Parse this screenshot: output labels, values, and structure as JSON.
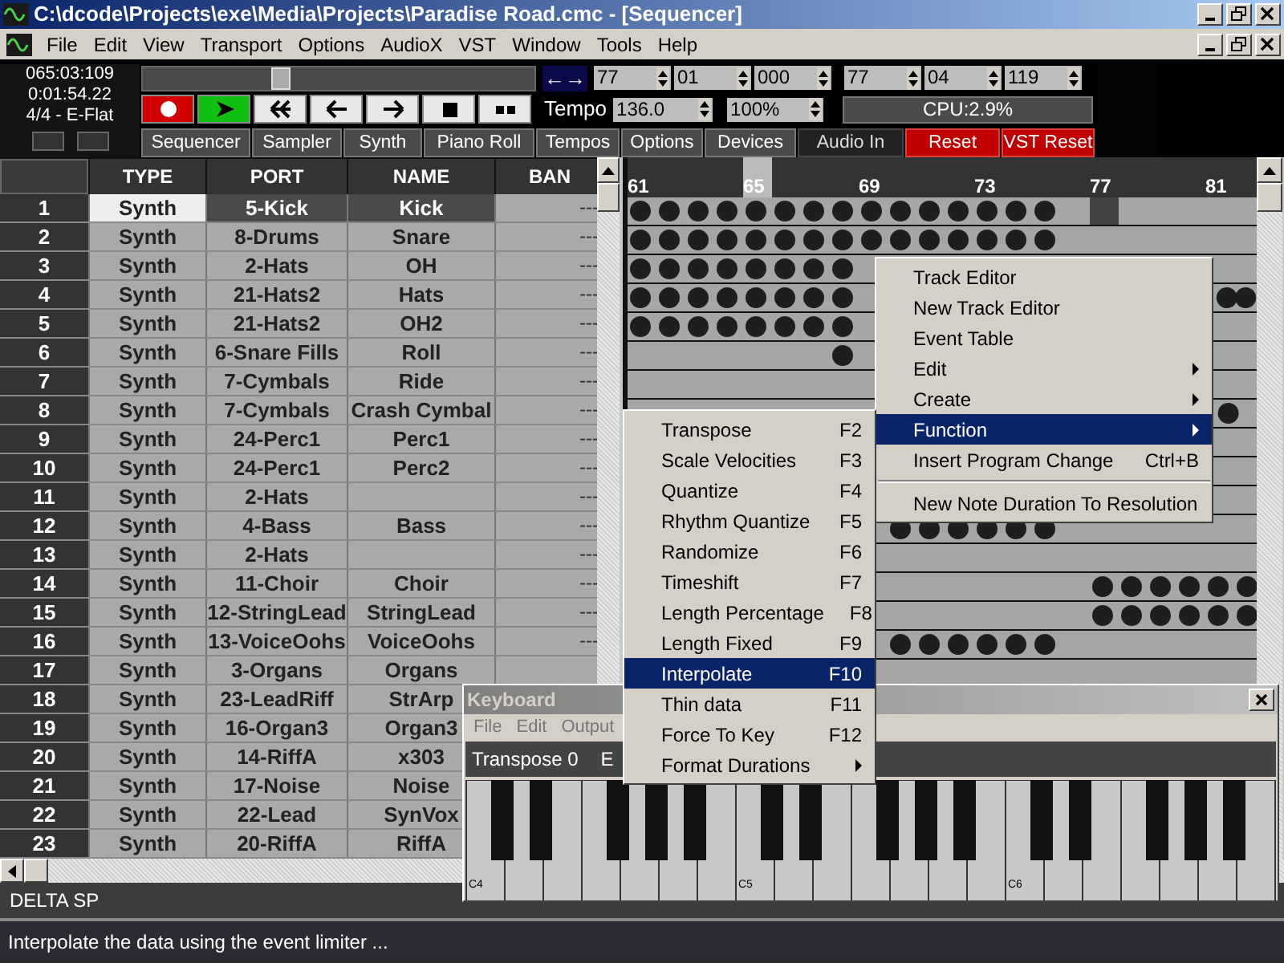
{
  "window": {
    "title": "C:\\dcode\\Projects\\exe\\Media\\Projects\\Paradise Road.cmc - [Sequencer]"
  },
  "menu_bar": [
    "File",
    "Edit",
    "View",
    "Transport",
    "Options",
    "AudioX",
    "VST",
    "Window",
    "Tools",
    "Help"
  ],
  "position": {
    "bar_beat_tick": "065:03:109",
    "time": "0:01:54.22",
    "signature_key": "4/4 - E-Flat"
  },
  "song_slider": {
    "level": 0.34
  },
  "transport": [
    {
      "kind": "record"
    },
    {
      "kind": "play"
    },
    {
      "kind": "rewind"
    },
    {
      "kind": "back"
    },
    {
      "kind": "forward"
    },
    {
      "kind": "stop"
    },
    {
      "kind": "end"
    }
  ],
  "loop_toggle": "←→",
  "locators": [
    "77",
    "01",
    "000",
    "77",
    "04",
    "119"
  ],
  "tempo": {
    "label": "Tempo",
    "value": "136.0",
    "speed": "100%"
  },
  "cpu": "CPU:2.9%",
  "view_tabs": [
    {
      "label": "Sequencer",
      "kind": "normal"
    },
    {
      "label": "Sampler",
      "kind": "normal"
    },
    {
      "label": "Synth",
      "kind": "normal"
    },
    {
      "label": "Piano Roll",
      "kind": "normal"
    },
    {
      "label": "Tempos",
      "kind": "normal"
    },
    {
      "label": "Options",
      "kind": "normal"
    },
    {
      "label": "Devices",
      "kind": "normal"
    },
    {
      "label": "Audio In",
      "kind": "dark"
    },
    {
      "label": "Reset",
      "kind": "alert"
    },
    {
      "label": "VST Reset",
      "kind": "alert"
    }
  ],
  "tracks": {
    "columns": [
      "TYPE",
      "PORT",
      "NAME",
      "BAN"
    ],
    "rows": [
      {
        "number": "1",
        "type": "Synth",
        "port": "5-Kick",
        "name": "Kick",
        "bank": "---",
        "selected": true
      },
      {
        "number": "2",
        "type": "Synth",
        "port": "8-Drums",
        "name": "Snare",
        "bank": "---",
        "selected": false
      },
      {
        "number": "3",
        "type": "Synth",
        "port": "2-Hats",
        "name": "OH",
        "bank": "---",
        "selected": false
      },
      {
        "number": "4",
        "type": "Synth",
        "port": "21-Hats2",
        "name": "Hats",
        "bank": "---",
        "selected": false
      },
      {
        "number": "5",
        "type": "Synth",
        "port": "21-Hats2",
        "name": "OH2",
        "bank": "---",
        "selected": false
      },
      {
        "number": "6",
        "type": "Synth",
        "port": "6-Snare Fills",
        "name": "Roll",
        "bank": "---",
        "selected": false
      },
      {
        "number": "7",
        "type": "Synth",
        "port": "7-Cymbals",
        "name": "Ride",
        "bank": "---",
        "selected": false
      },
      {
        "number": "8",
        "type": "Synth",
        "port": "7-Cymbals",
        "name": "Crash Cymbal",
        "bank": "---",
        "selected": false
      },
      {
        "number": "9",
        "type": "Synth",
        "port": "24-Perc1",
        "name": "Perc1",
        "bank": "---",
        "selected": false
      },
      {
        "number": "10",
        "type": "Synth",
        "port": "24-Perc1",
        "name": "Perc2",
        "bank": "---",
        "selected": false
      },
      {
        "number": "11",
        "type": "Synth",
        "port": "2-Hats",
        "bank": "---",
        "selected": false
      },
      {
        "number": "12",
        "type": "Synth",
        "port": "4-Bass",
        "name": "Bass",
        "bank": "---",
        "selected": false
      },
      {
        "number": "13",
        "type": "Synth",
        "port": "2-Hats",
        "bank": "---",
        "selected": false
      },
      {
        "number": "14",
        "type": "Synth",
        "port": "11-Choir",
        "name": "Choir",
        "bank": "---",
        "selected": false
      },
      {
        "number": "15",
        "type": "Synth",
        "port": "12-StringLead",
        "name": "StringLead",
        "bank": "---",
        "selected": false
      },
      {
        "number": "16",
        "type": "Synth",
        "port": "13-VoiceOohs",
        "name": "VoiceOohs",
        "bank": "---",
        "selected": false
      },
      {
        "number": "17",
        "type": "Synth",
        "port": "3-Organs",
        "name": "Organs",
        "selected": false
      },
      {
        "number": "18",
        "type": "Synth",
        "port": "23-LeadRiff",
        "name": "StrArp",
        "selected": false
      },
      {
        "number": "19",
        "type": "Synth",
        "port": "16-Organ3",
        "name": "Organ3",
        "selected": false
      },
      {
        "number": "20",
        "type": "Synth",
        "port": "14-RiffA",
        "name": "x303",
        "selected": false
      },
      {
        "number": "21",
        "type": "Synth",
        "port": "17-Noise",
        "name": "Noise",
        "selected": false
      },
      {
        "number": "22",
        "type": "Synth",
        "port": "22-Lead",
        "name": "SynVox",
        "selected": false
      },
      {
        "number": "23",
        "type": "Synth",
        "port": "20-RiffA",
        "name": "RiffA",
        "selected": false
      }
    ]
  },
  "piano_roll": {
    "bar_numbers": [
      "61",
      "65",
      "69",
      "73",
      "77",
      "81"
    ]
  },
  "context_menu": {
    "items": [
      {
        "kind": "item",
        "label": "Track Editor",
        "selected": false
      },
      {
        "kind": "item",
        "label": "New Track Editor",
        "selected": false
      },
      {
        "kind": "item",
        "label": "Event Table",
        "selected": false
      },
      {
        "kind": "submenu",
        "label": "Edit",
        "selected": false
      },
      {
        "kind": "submenu",
        "label": "Create",
        "selected": false
      },
      {
        "kind": "submenu",
        "label": "Function",
        "selected": true
      },
      {
        "kind": "item",
        "label": "Insert Program Change",
        "shortcut": "Ctrl+B",
        "selected": false
      },
      {
        "kind": "separator"
      },
      {
        "kind": "item",
        "label": "New Note Duration To Resolution",
        "selected": false
      }
    ]
  },
  "function_submenu": {
    "items": [
      {
        "kind": "item",
        "label": "Transpose",
        "shortcut": "F2",
        "selected": false
      },
      {
        "kind": "item",
        "label": "Scale Velocities",
        "shortcut": "F3",
        "selected": false
      },
      {
        "kind": "item",
        "label": "Quantize",
        "shortcut": "F4",
        "selected": false
      },
      {
        "kind": "item",
        "label": "Rhythm Quantize",
        "shortcut": "F5",
        "selected": false
      },
      {
        "kind": "item",
        "label": "Randomize",
        "shortcut": "F6",
        "selected": false
      },
      {
        "kind": "item",
        "label": "Timeshift",
        "shortcut": "F7",
        "selected": false
      },
      {
        "kind": "item",
        "label": "Length Percentage",
        "shortcut": "F8",
        "selected": false
      },
      {
        "kind": "item",
        "label": "Length Fixed",
        "shortcut": "F9",
        "selected": false
      },
      {
        "kind": "item",
        "label": "Interpolate",
        "shortcut": "F10",
        "selected": true
      },
      {
        "kind": "item",
        "label": "Thin data",
        "shortcut": "F11",
        "selected": false
      },
      {
        "kind": "item",
        "label": "Force To Key",
        "shortcut": "F12",
        "selected": false
      },
      {
        "kind": "submenu",
        "label": "Format Durations",
        "selected": false
      }
    ]
  },
  "keyboard_window": {
    "title": "Keyboard",
    "menu": [
      "File",
      "Edit",
      "Output"
    ],
    "transpose": "Transpose 0",
    "field_2": "E",
    "octave_labels": [
      "C4",
      "C5",
      "C6"
    ]
  },
  "track_footer": "DELTA SP",
  "status_bar": "Interpolate the data using the event limiter ..."
}
